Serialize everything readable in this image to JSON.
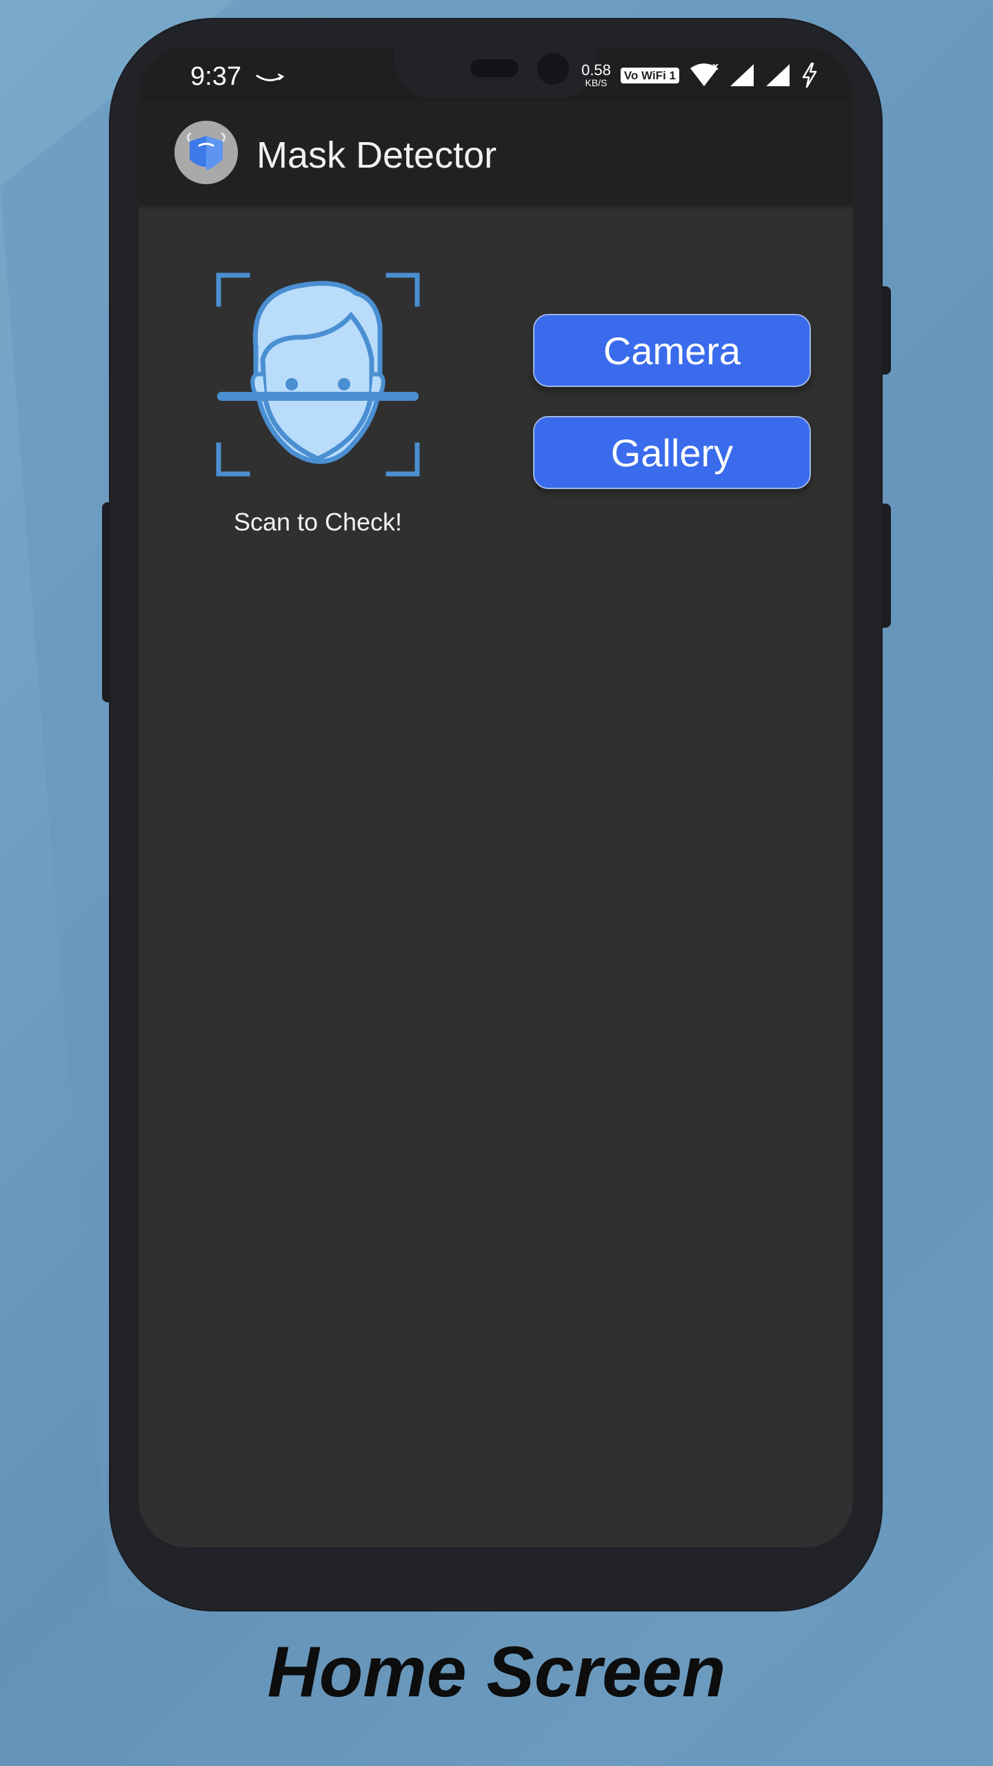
{
  "status_bar": {
    "time": "9:37",
    "net_speed_value": "0.58",
    "net_speed_unit": "KB/S",
    "vowifi_label": "Vo WiFi 1",
    "icons": [
      "amazon-smile-icon",
      "vowifi-icon",
      "wifi-icon",
      "signal-icon",
      "signal-icon",
      "charging-icon"
    ]
  },
  "app_bar": {
    "title": "Mask Detector",
    "logo_icon": "mask-icon"
  },
  "main": {
    "scan_icon": "face-scan-icon",
    "scan_label": "Scan to Check!",
    "camera_button": "Camera",
    "gallery_button": "Gallery"
  },
  "caption": "Home Screen",
  "colors": {
    "background": "#6a9cc0",
    "screen": "#303030",
    "app_bar": "#212121",
    "button": "#3a6bec",
    "face_fill": "#b9dcfb",
    "face_stroke": "#4a8fd1"
  }
}
